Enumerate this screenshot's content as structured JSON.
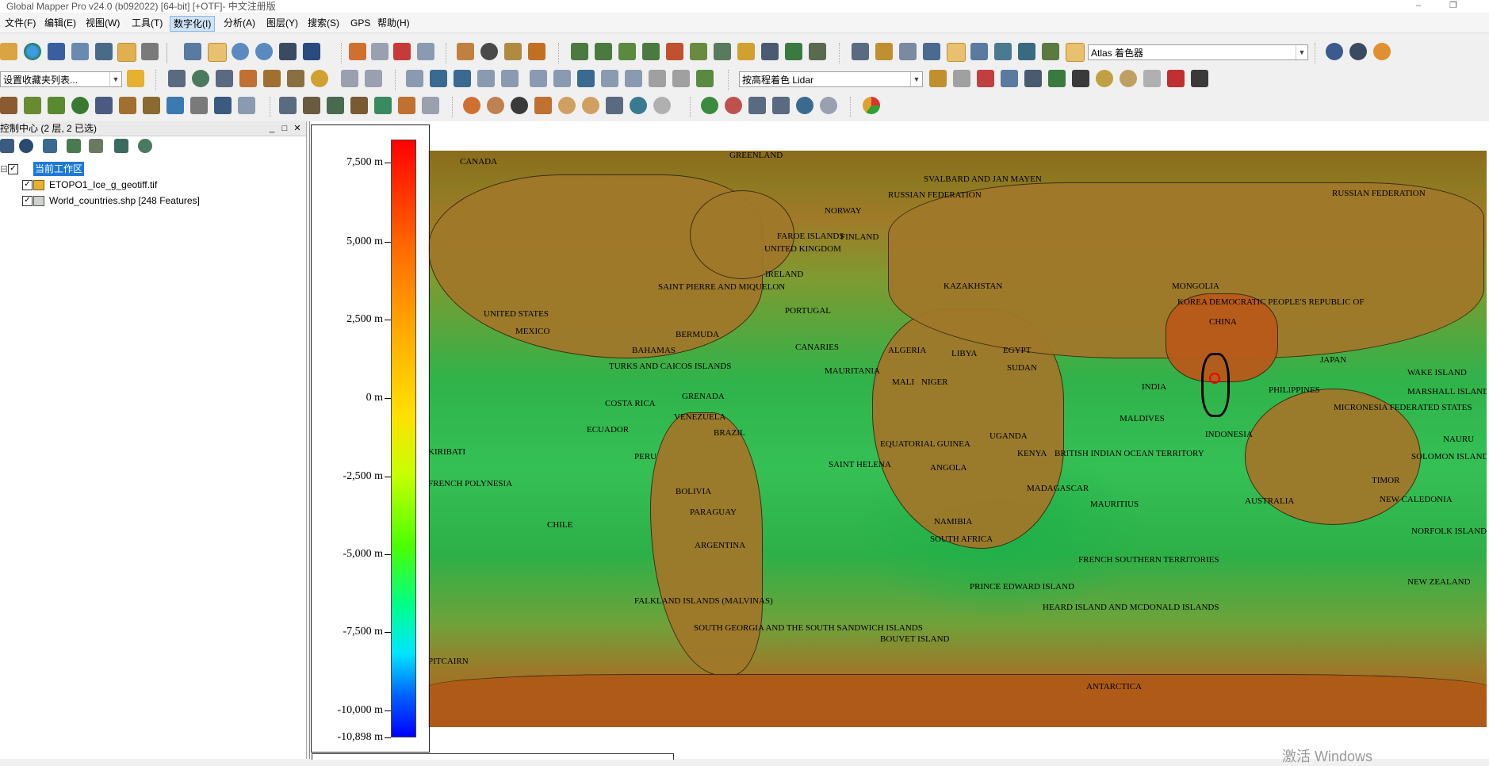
{
  "window": {
    "title": "Global Mapper Pro v24.0 (b092022) [64-bit] [+OTF]- 中文注册版",
    "minimize": "–",
    "restore": "❐",
    "close": "✕"
  },
  "menu": [
    {
      "label": "文件(F)"
    },
    {
      "label": "编辑(E)"
    },
    {
      "label": "视图(W)"
    },
    {
      "label": "工具(T)"
    },
    {
      "label": "数字化(I)"
    },
    {
      "label": "分析(A)"
    },
    {
      "label": "图层(Y)"
    },
    {
      "label": "搜索(S)"
    },
    {
      "label": "GPS"
    },
    {
      "label": "帮助(H)"
    }
  ],
  "toolbar": {
    "shader_dropdown": "Atlas 着色器",
    "favorites_dropdown": "设置收藏夹列表...",
    "color_by_dropdown": "按高程着色 Lidar"
  },
  "control_center": {
    "title": "控制中心 (2 层, 2 已选)",
    "workspace_label": "当前工作区",
    "layers": [
      {
        "name": "ETOPO1_Ice_g_geotiff.tif"
      },
      {
        "name": "World_countries.shp [248 Features]"
      }
    ]
  },
  "legend": {
    "labels": [
      "7,500 m",
      "5,000 m",
      "2,500 m",
      "0 m",
      "-2,500 m",
      "-5,000 m",
      "-7,500 m",
      "-10,000 m",
      "-10,898 m"
    ]
  },
  "map_labels": [
    "CANADA",
    "GREENLAND",
    "SVALBARD AND JAN MAYEN",
    "RUSSIAN FEDERATION",
    "RUSSIAN FEDERATION",
    "NORWAY",
    "FINLAND",
    "UNITED KINGDOM",
    "IRELAND",
    "FAROE ISLANDS",
    "KAZAKHSTAN",
    "MONGOLIA",
    "KOREA DEMOCRATIC PEOPLE'S REPUBLIC OF",
    "CHINA",
    "JAPAN",
    "INDIA",
    "UNITED STATES",
    "SAINT PIERRE AND MIQUELON",
    "PORTUGAL",
    "BERMUDA",
    "BAHAMAS",
    "TURKS AND CAICOS ISLANDS",
    "MEXICO",
    "ALGERIA",
    "LIBYA",
    "EGYPT",
    "MAURITANIA",
    "MALI",
    "NIGER",
    "SUDAN",
    "CANARIES",
    "GRENADA",
    "COSTA RICA",
    "VENEZUELA",
    "ECUADOR",
    "BRAZIL",
    "PERU",
    "BOLIVIA",
    "PARAGUAY",
    "CHILE",
    "ARGENTINA",
    "FALKLAND ISLANDS (MALVINAS)",
    "SOUTH GEORGIA AND THE SOUTH SANDWICH ISLANDS",
    "EQUATORIAL GUINEA",
    "UGANDA",
    "KENYA",
    "ANGOLA",
    "NAMIBIA",
    "SOUTH AFRICA",
    "MADAGASCAR",
    "MAURITIUS",
    "SAINT HELENA",
    "BRITISH INDIAN OCEAN TERRITORY",
    "MALDIVES",
    "INDONESIA",
    "PHILIPPINES",
    "MARSHALL ISLANDS",
    "MICRONESIA FEDERATED STATES",
    "NAURU",
    "SOLOMON ISLANDS",
    "NEW CALEDONIA",
    "AUSTRALIA",
    "NORFOLK ISLAND",
    "NEW ZEALAND",
    "FRENCH SOUTHERN TERRITORIES",
    "PRINCE EDWARD ISLAND",
    "HEARD ISLAND AND MCDONALD ISLANDS",
    "BOUVET ISLAND",
    "PITCAIRN",
    "FRENCH POLYNESIA",
    "KIRIBATI",
    "ANTARCTICA",
    "WAKE ISLAND",
    "TIMOR"
  ],
  "watermark": "激活 Windows"
}
